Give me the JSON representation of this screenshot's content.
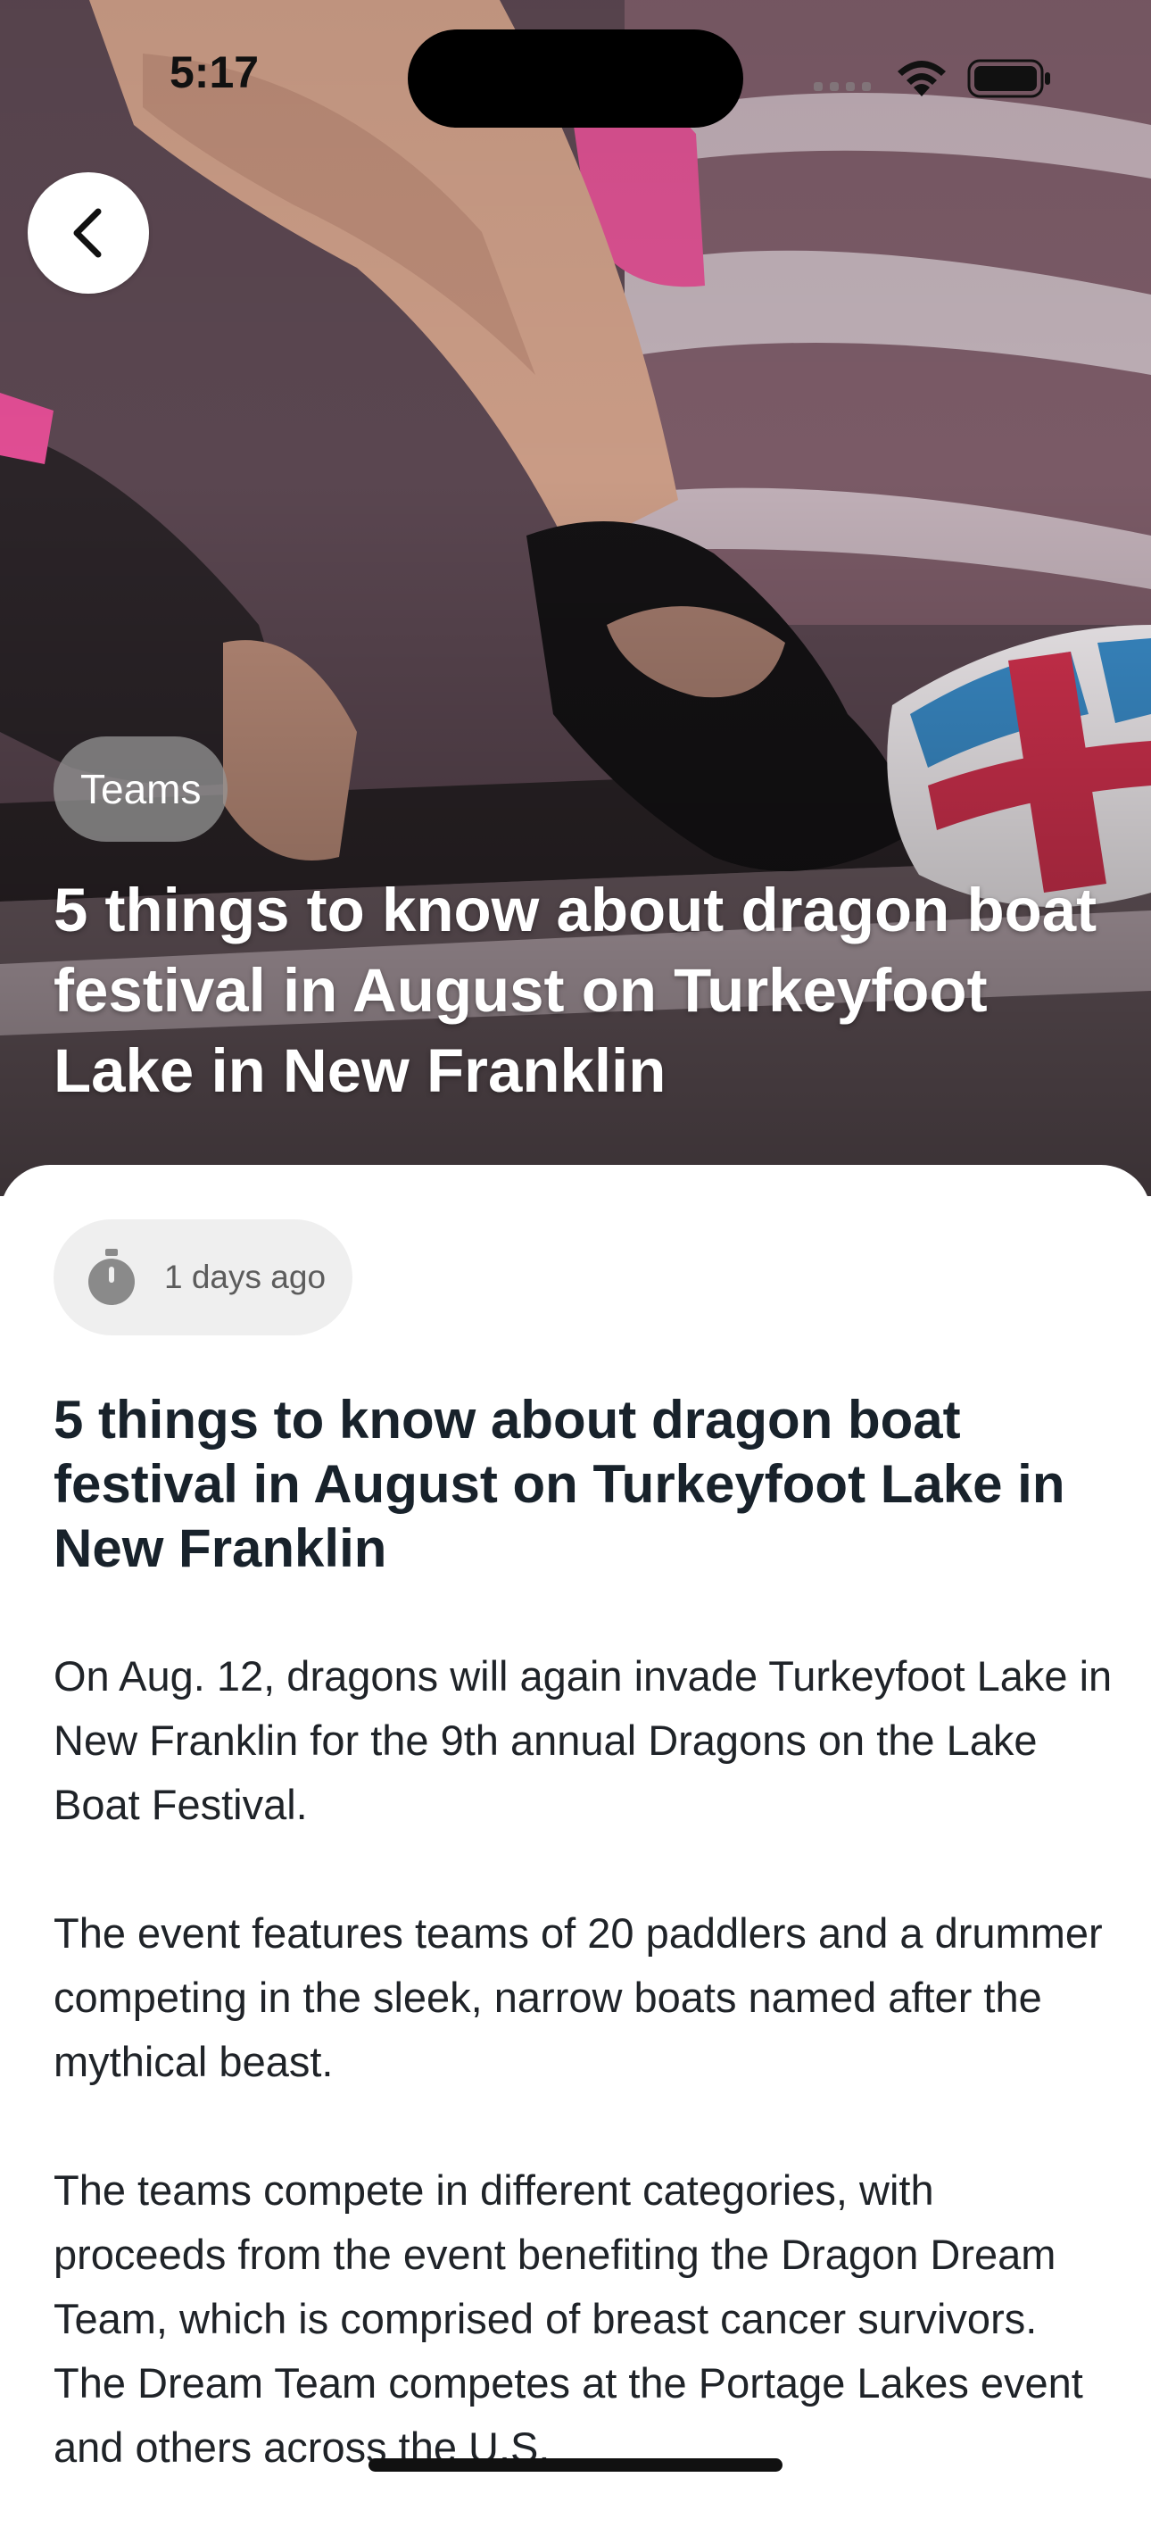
{
  "status_bar": {
    "time": "5:17"
  },
  "hero": {
    "category": "Teams",
    "title": "5 things to know about dragon boat festival in August on Turkeyfoot Lake in New Franklin"
  },
  "article": {
    "time_ago": "1 days ago",
    "title": "5 things to know about dragon boat festival in August on Turkeyfoot Lake in New Franklin",
    "paragraphs": [
      "On Aug. 12, dragons will again invade Turkeyfoot Lake in New Franklin for the 9th annual Dragons on the Lake Boat Festival.",
      "The event features teams of 20 paddlers and a drummer competing in the sleek, narrow boats named after the mythical beast.",
      "The teams compete in different categories, with proceeds from the event benefiting the Dragon Dream Team, which is comprised of breast cancer survivors. The Dream Team competes at the Portage Lakes event and others across the U.S."
    ]
  },
  "icons": {
    "back": "chevron-left-icon",
    "timer": "stopwatch-icon",
    "signal": "cellular-signal-icon",
    "wifi": "wifi-icon",
    "battery": "battery-icon"
  }
}
